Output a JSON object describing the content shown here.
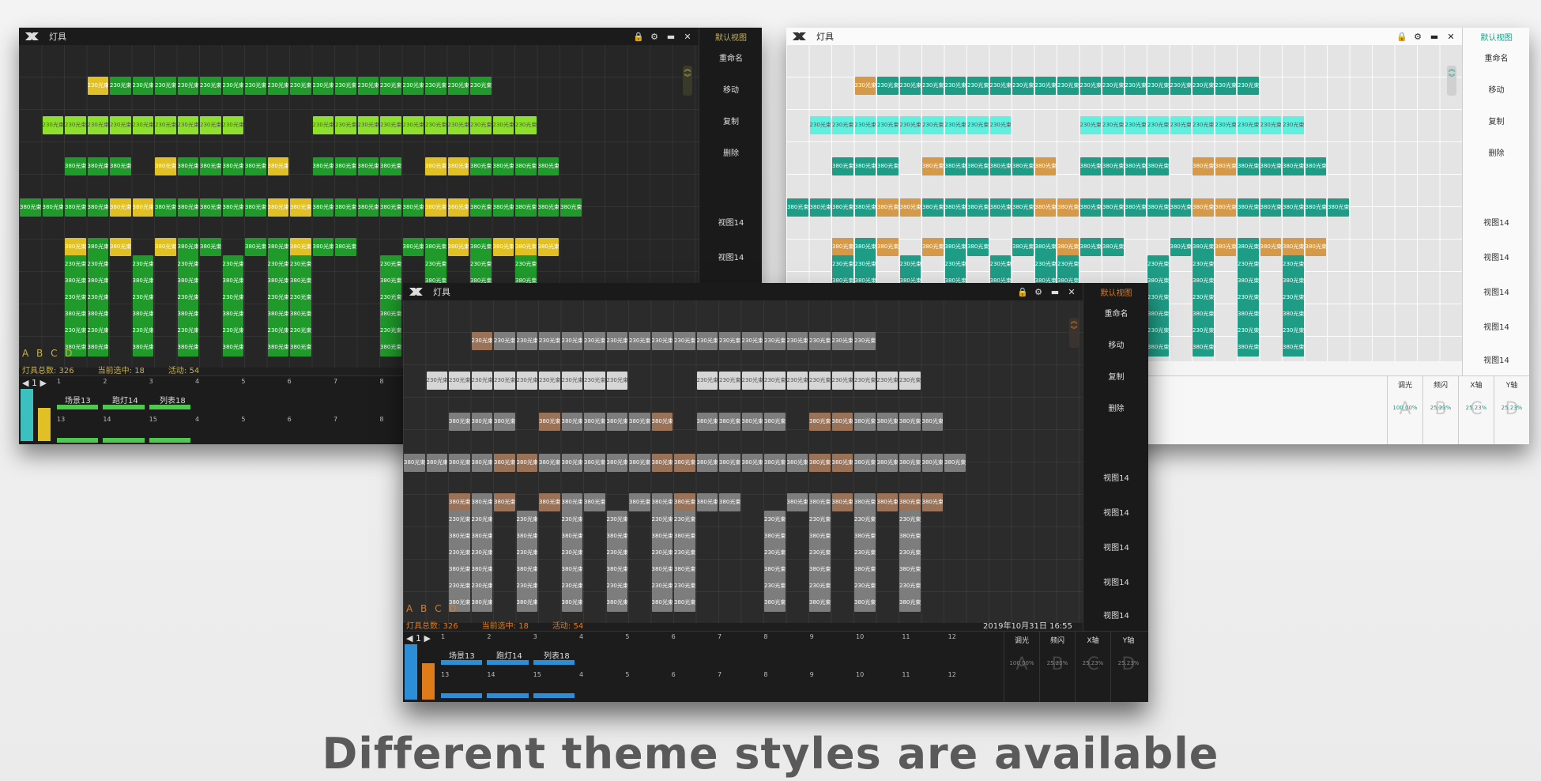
{
  "caption": "Different theme styles are available",
  "window_title": "灯具",
  "default_view": "默认视图",
  "side_buttons": [
    "重命名",
    "移动",
    "复制",
    "删除"
  ],
  "view_items": [
    "视图14",
    "视图14",
    "视图14",
    "视图14",
    "视图14"
  ],
  "abcd": "A B C D",
  "status": {
    "total": "灯具总数: 326",
    "selected": "当前选中: 18",
    "active": "活动: 54"
  },
  "datetime": "2019年10月31日 16:55",
  "cell_labels": {
    "a": "230光束",
    "b": "380光束"
  },
  "scene_tabs": [
    "场景13",
    "跑灯14",
    "列表18"
  ],
  "slot_numbers_top": [
    "1",
    "2",
    "3",
    "4",
    "5",
    "6",
    "7",
    "8",
    "9",
    "10",
    "11",
    "12"
  ],
  "slot_numbers_bottom": [
    "13",
    "14",
    "15",
    "4",
    "5",
    "6",
    "7",
    "8",
    "9",
    "10",
    "11",
    "12"
  ],
  "page_number": "1",
  "param_headers": [
    "调光",
    "频闪",
    "X轴",
    "Y轴"
  ],
  "param_letters": [
    "A",
    "B",
    "C",
    "D"
  ],
  "param_values": [
    "100.00%",
    "25.23%",
    "25.23%",
    "25.23%"
  ],
  "themes": {
    "green": {
      "bg": "#262626",
      "c1": "#1f9a2b",
      "c2": "#8de02c",
      "c3": "#e0c024",
      "accent": "#c9b04a"
    },
    "teal": {
      "bg": "#e4e4e4",
      "c1": "#1f9c86",
      "c2": "#5ff0e0",
      "c3": "#d49a4a",
      "accent": "#16a085"
    },
    "gray": {
      "bg": "#2b2b2b",
      "c1": "#7d7d7d",
      "c2": "#d6d6d6",
      "c3": "#9a7257",
      "accent": "#e07b1a"
    }
  }
}
